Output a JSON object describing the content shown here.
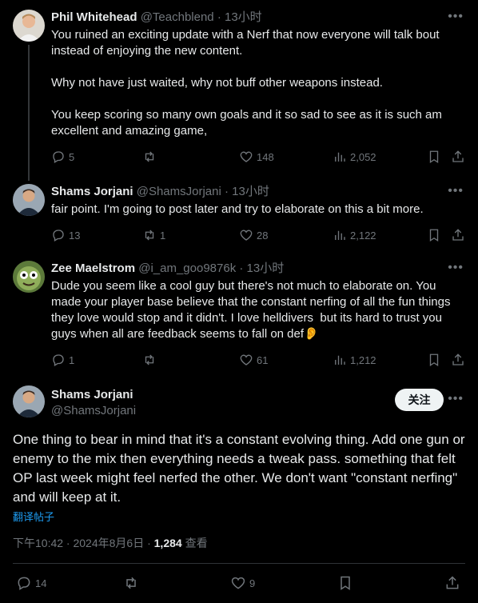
{
  "reply1": {
    "name": "Phil Whitehead",
    "handle": "@Teachblend",
    "time": "· 13小时",
    "text": "You ruined an exciting update with a Nerf that now everyone will talk bout instead of enjoying the new content.\n\nWhy not have just waited, why not buff other weapons instead.\n\nYou keep scoring so many own goals and it so sad to see as it is such am excellent and amazing game,",
    "replies": "5",
    "reposts": "",
    "likes": "148",
    "views": "2,052"
  },
  "reply2": {
    "name": "Shams Jorjani",
    "handle": "@ShamsJorjani",
    "time": "· 13小时",
    "text": "fair point. I'm going to post later and try to elaborate on this a bit more.",
    "replies": "13",
    "reposts": "1",
    "likes": "28",
    "views": "2,122"
  },
  "reply3": {
    "name": "Zee Maelstrom",
    "handle": "@i_am_goo9876k",
    "time": "· 13小时",
    "text": "Dude you seem like a cool guy but there's not much to elaborate on. You made your player base believe that the constant nerfing of all the fun things they love would stop and it didn't. I love helldivers  but its hard to trust you guys when all are feedback seems to fall on def👂",
    "replies": "1",
    "reposts": "",
    "likes": "61",
    "views": "1,212"
  },
  "main": {
    "name": "Shams Jorjani",
    "handle": "@ShamsJorjani",
    "follow": "关注",
    "text": "One thing to bear in mind that it's a constant evolving thing. Add one gun or enemy to the mix then everything needs a tweak pass. something that felt OP last week might feel nerfed the other. We don't want \"constant nerfing\" and will keep at it.",
    "translate": "翻译帖子",
    "timestamp": "下午10:42 · 2024年8月6日 · ",
    "views": "1,284",
    "views_label": " 查看",
    "replies": "14",
    "reposts": "",
    "likes": "9"
  },
  "colors": {
    "bg": "#000000",
    "text": "#e7e9ea",
    "muted": "#71767b",
    "link": "#1d9bf0"
  }
}
